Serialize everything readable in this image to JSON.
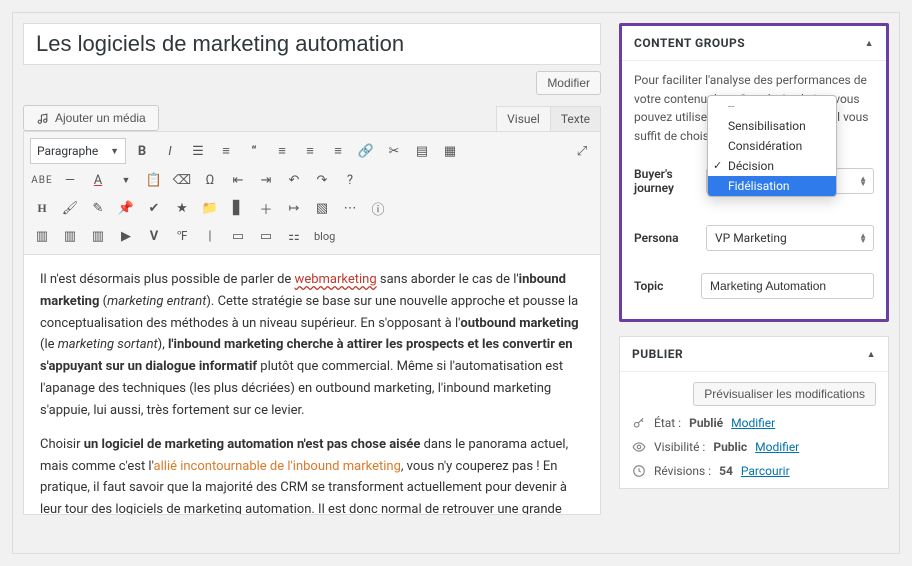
{
  "title": "Les logiciels de marketing automation",
  "buttons": {
    "modifier": "Modifier",
    "add_media": "Ajouter un média"
  },
  "tabs": {
    "visual": "Visuel",
    "text": "Texte"
  },
  "toolbar": {
    "format_select": "Paragraphe",
    "row1_icons": [
      "bold",
      "italic",
      "bullist",
      "numlist",
      "blockquote",
      "alignleft",
      "aligncenter",
      "alignright",
      "link",
      "unlink",
      "readmore",
      "fullscreen",
      "kitchensink",
      "distraction-free"
    ],
    "row2_prefix": "ABE",
    "row2_icons": [
      "hr",
      "textcolor",
      "textcolor2",
      "clipboard",
      "eraser",
      "omega",
      "outdent",
      "indent",
      "undo",
      "redo",
      "help"
    ],
    "row3_icons": [
      "heading",
      "brush",
      "pencil",
      "thumbtack",
      "check",
      "star",
      "folder",
      "book",
      "plus",
      "arrow-right",
      "image",
      "ellipsis",
      "info"
    ],
    "row4_icons": [
      "col2",
      "col3",
      "col4",
      "play-square",
      "vimeo",
      "fahrenheit",
      "sep",
      "card",
      "creditcard",
      "dollar",
      "blog"
    ],
    "blog_label": "blog"
  },
  "content": {
    "p1_a": "Il n'est désormais plus possible de parler de ",
    "p1_link1": "webmarketing",
    "p1_b": " sans aborder le cas de l'",
    "p1_bold1": "inbound marketing",
    "p1_c": " (",
    "p1_it1": "marketing entrant",
    "p1_d": "). Cette stratégie se base sur une nouvelle approche et pousse la conceptualisation des méthodes à un niveau supérieur. En s'opposant à l'",
    "p1_bold2": "outbound marketing",
    "p1_e": " (le ",
    "p1_it2": "marketing sortant",
    "p1_f": "), ",
    "p1_bold3": "l'inbound marketing cherche à attirer les prospects et les convertir en s'appuyant sur un dialogue informatif",
    "p1_g": " plutôt que commercial. Même si l'automatisation est l'apanage des techniques (les plus décriées) en outbound marketing, l'inbound marketing s'appuie, lui aussi, très fortement sur ce levier.",
    "p2_a": "Choisir ",
    "p2_bold1": "un logiciel de marketing automation n'est pas chose aisée",
    "p2_b": " dans le panorama actuel, mais comme c'est l'",
    "p2_link1": "allié incontournable de l'inbound marketing",
    "p2_c": ", vous n'y couperez pas ! En pratique, il faut savoir que la majorité des CRM se transforment actuellement pour devenir à leur tour des logiciels de marketing automation. Il est donc normal de retrouver une grande diversité d'outils et de critères de sélection. Nous avons choisi de vous présenter une dizaine de solutions logicielles, parmi les plus utilisées en France."
  },
  "sidebar": {
    "content_groups": {
      "title": "CONTENT GROUPS",
      "desc_a": "Pour faciliter l'analyse des performances de votre contenu dans Google Analytics, vous pouvez utiliser le \"Content Grouping\". Il vous suffit de choisir les champs ci-",
      "buyer_label": "Buyer's journey",
      "buyer_options": [
        "--",
        "Sensibilisation",
        "Considération",
        "Décision",
        "Fidélisation"
      ],
      "buyer_checked": "Décision",
      "buyer_highlight": "Fidélisation",
      "persona_label": "Persona",
      "persona_value": "VP Marketing",
      "topic_label": "Topic",
      "topic_value": "Marketing Automation"
    },
    "publish": {
      "title": "PUBLIER",
      "preview": "Prévisualiser les modifications",
      "state_label": "État : ",
      "state_value": "Publié",
      "visibility_label": "Visibilité : ",
      "visibility_value": "Public",
      "revisions_label": "Révisions : ",
      "revisions_value": "54",
      "edit": "Modifier",
      "browse": "Parcourir"
    }
  }
}
